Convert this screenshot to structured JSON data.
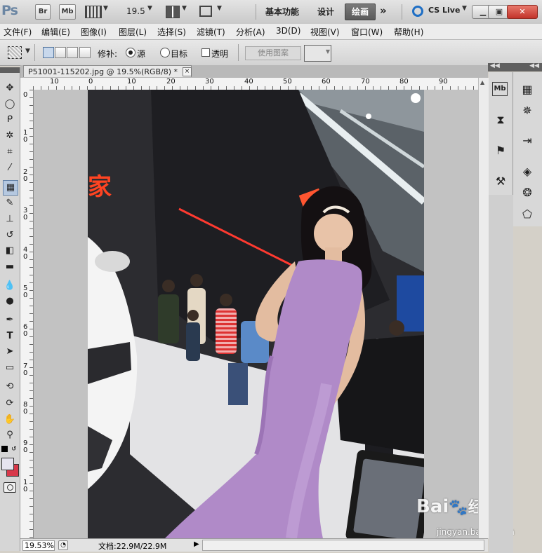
{
  "app": {
    "logo": "Ps",
    "bridge_label": "Br",
    "minibridge_label": "Mb",
    "zoom_value": "19.5",
    "workspaces": [
      "基本功能",
      "设计",
      "绘画"
    ],
    "active_workspace": "绘画",
    "more_workspaces": "»",
    "cs_live": "CS Live",
    "window_buttons": [
      "minimize",
      "maximize",
      "close"
    ]
  },
  "menu": [
    "文件(F)",
    "编辑(E)",
    "图像(I)",
    "图层(L)",
    "选择(S)",
    "滤镜(T)",
    "分析(A)",
    "3D(D)",
    "视图(V)",
    "窗口(W)",
    "帮助(H)"
  ],
  "options": {
    "patch_label": "修补:",
    "source_label": "源",
    "target_label": "目标",
    "transparent_label": "透明",
    "use_pattern_label": "使用图案",
    "source_selected": true
  },
  "document": {
    "tab_title": "P51001-115202.jpg @ 19.5%(RGB/8) *",
    "close_glyph": "×"
  },
  "rulers": {
    "horizontal_labels": [
      "10",
      "0",
      "10",
      "20",
      "30",
      "40",
      "50",
      "60",
      "70",
      "80",
      "90"
    ],
    "vertical_labels": [
      "0",
      "1\n0",
      "2\n0",
      "3\n0",
      "4\n0",
      "5\n0",
      "6\n0",
      "7\n0",
      "8\n0",
      "9\n0",
      "1\n0"
    ]
  },
  "status": {
    "zoom": "19.53%",
    "doc_size": "文档:22.9M/22.9M",
    "arrow": "▶"
  },
  "photo": {
    "sign_text": "家",
    "badge_text": "…"
  },
  "watermark": {
    "brand": "Bai",
    "paw": "du",
    "site_cn": "经验",
    "site_url": "jingyan.baidu.com"
  },
  "colors": {
    "dress": "#b08ac8",
    "accent_red": "#d8384a",
    "active_ws": "#5a5a5a"
  }
}
